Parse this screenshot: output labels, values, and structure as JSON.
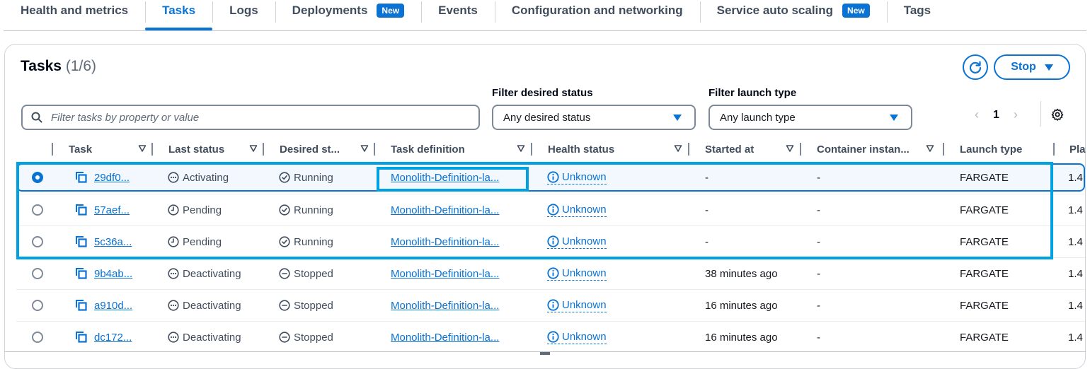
{
  "tabs": [
    {
      "label": "Health and metrics",
      "active": false,
      "badge": null
    },
    {
      "label": "Tasks",
      "active": true,
      "badge": null
    },
    {
      "label": "Logs",
      "active": false,
      "badge": null
    },
    {
      "label": "Deployments",
      "active": false,
      "badge": "New"
    },
    {
      "label": "Events",
      "active": false,
      "badge": null
    },
    {
      "label": "Configuration and networking",
      "active": false,
      "badge": null
    },
    {
      "label": "Service auto scaling",
      "active": false,
      "badge": "New"
    },
    {
      "label": "Tags",
      "active": false,
      "badge": null
    }
  ],
  "panel": {
    "title": "Tasks",
    "count": "(1/6)",
    "refresh_icon": "refresh-icon",
    "stop_label": "Stop"
  },
  "filters": {
    "search_placeholder": "Filter tasks by property or value",
    "search_value": "",
    "desired_status_label": "Filter desired status",
    "desired_status_value": "Any desired status",
    "launch_type_label": "Filter launch type",
    "launch_type_value": "Any launch type"
  },
  "pagination": {
    "current_page": "1",
    "prev": "‹",
    "next": "›"
  },
  "columns": [
    "Task",
    "Last status",
    "Desired st...",
    "Task definition",
    "Health status",
    "Started at",
    "Container instan...",
    "Launch type",
    "Pla"
  ],
  "rows": [
    {
      "selected": true,
      "task": "29df0...",
      "last_status": "Activating",
      "last_icon": "ellipsis",
      "desired": "Running",
      "desired_icon": "check",
      "task_def": "Monolith-Definition-la...",
      "health": "Unknown",
      "started": "-",
      "container": "-",
      "launch": "FARGATE",
      "platform": "1.4"
    },
    {
      "selected": false,
      "task": "57aef...",
      "last_status": "Pending",
      "last_icon": "clock",
      "desired": "Running",
      "desired_icon": "check",
      "task_def": "Monolith-Definition-la...",
      "health": "Unknown",
      "started": "-",
      "container": "-",
      "launch": "FARGATE",
      "platform": "1.4"
    },
    {
      "selected": false,
      "task": "5c36a...",
      "last_status": "Pending",
      "last_icon": "clock",
      "desired": "Running",
      "desired_icon": "check",
      "task_def": "Monolith-Definition-la...",
      "health": "Unknown",
      "started": "-",
      "container": "-",
      "launch": "FARGATE",
      "platform": "1.4"
    },
    {
      "selected": false,
      "task": "9b4ab...",
      "last_status": "Deactivating",
      "last_icon": "ellipsis",
      "desired": "Stopped",
      "desired_icon": "minus",
      "task_def": "Monolith-Definition-la...",
      "health": "Unknown",
      "started": "38 minutes ago",
      "container": "-",
      "launch": "FARGATE",
      "platform": "1.4"
    },
    {
      "selected": false,
      "task": "a910d...",
      "last_status": "Deactivating",
      "last_icon": "ellipsis",
      "desired": "Stopped",
      "desired_icon": "minus",
      "task_def": "Monolith-Definition-la...",
      "health": "Unknown",
      "started": "16 minutes ago",
      "container": "-",
      "launch": "FARGATE",
      "platform": "1.4"
    },
    {
      "selected": false,
      "task": "dc172...",
      "last_status": "Deactivating",
      "last_icon": "ellipsis",
      "desired": "Stopped",
      "desired_icon": "minus",
      "task_def": "Monolith-Definition-la...",
      "health": "Unknown",
      "started": "16 minutes ago",
      "container": "-",
      "launch": "FARGATE",
      "platform": "1.4"
    }
  ],
  "colors": {
    "accent": "#0972d3",
    "highlight": "#00a1e0",
    "selected_bg": "#f2f8fd"
  }
}
